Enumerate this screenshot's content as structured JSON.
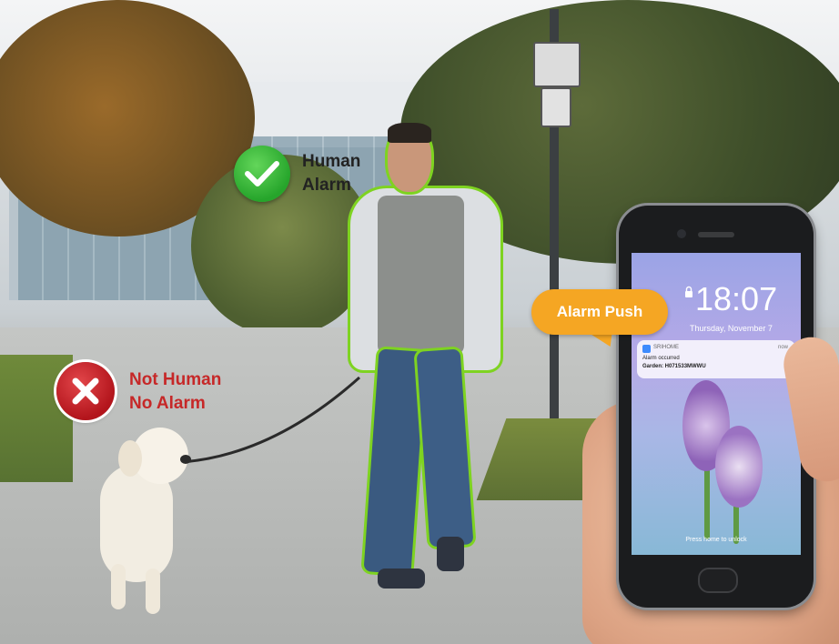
{
  "labels": {
    "human_alarm": [
      "Human",
      "Alarm"
    ],
    "not_human_alarm": [
      "Not Human",
      "No Alarm"
    ],
    "callout": "Alarm Push"
  },
  "phone": {
    "time": "18:07",
    "date": "Thursday, November 7",
    "notification": {
      "app": "SRIHOME",
      "when": "now",
      "title": "Alarm occurred",
      "body": "Garden: H071533MWWU"
    },
    "unlock_hint": "Press home to unlock"
  },
  "icons": {
    "human_badge": "check-icon",
    "not_human_badge": "close-icon"
  },
  "colors": {
    "detection_outline": "#7ed321",
    "check_badge": "#26a52b",
    "x_badge": "#c62828",
    "callout": "#f5a623"
  }
}
